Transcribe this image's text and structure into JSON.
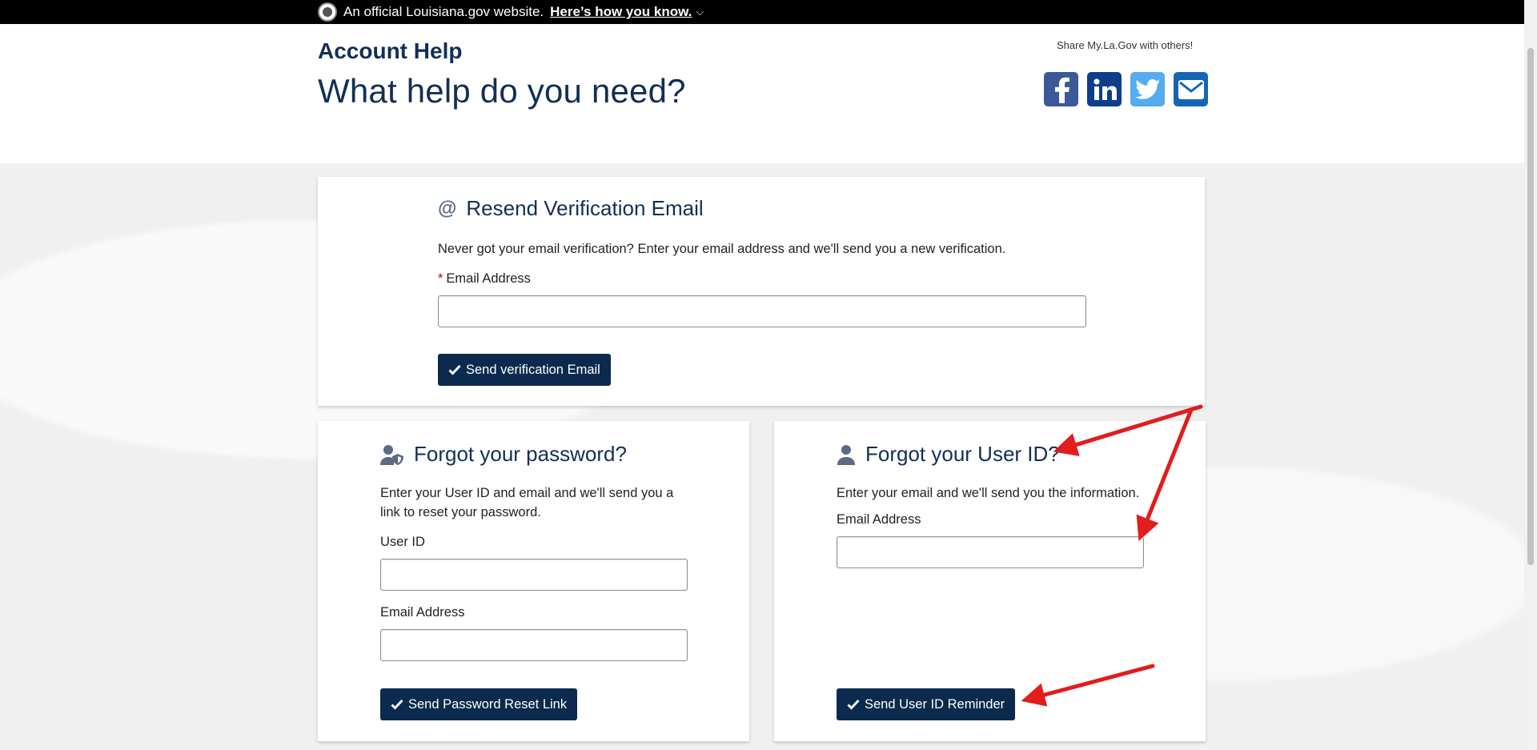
{
  "banner": {
    "text": "An official Louisiana.gov website.",
    "link": "Here’s how you know.",
    "icon": "louisiana-seal-icon"
  },
  "header": {
    "kicker": "Account Help",
    "title": "What help do you need?",
    "share_text": "Share My.La.Gov with others!",
    "share_icons": [
      "facebook-icon",
      "linkedin-icon",
      "twitter-icon",
      "email-icon"
    ]
  },
  "resend": {
    "title": "Resend Verification Email",
    "description": "Never got your email verification? Enter your email address and we'll send you a new verification.",
    "required_mark": "*",
    "email_label": "Email Address",
    "email_value": "",
    "button": "Send verification Email"
  },
  "password": {
    "title": "Forgot your password?",
    "description": "Enter your User ID and email and we'll send you a link to reset your password.",
    "userid_label": "User ID",
    "userid_value": "",
    "email_label": "Email Address",
    "email_value": "",
    "button": "Send Password Reset Link"
  },
  "userid": {
    "title": "Forgot your User ID?",
    "description": "Enter your email and we'll send you the information.",
    "email_label": "Email Address",
    "email_value": "",
    "button": "Send User ID Reminder"
  },
  "colors": {
    "navy": "#122f56",
    "button": "#0b2a4e",
    "facebook": "#3b5998",
    "linkedin": "#0e3d8c",
    "twitter": "#55acee",
    "email": "#1565b6",
    "arrow": "#e31c1c"
  }
}
